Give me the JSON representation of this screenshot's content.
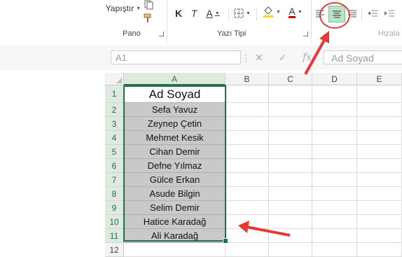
{
  "ribbon": {
    "paste_label": "Yapıştır",
    "group_pano": "Pano",
    "group_font": "Yazı Tipi",
    "group_align": "Hizala",
    "bold": "K",
    "italic": "T",
    "underline": "A",
    "font_color_letter": "A"
  },
  "formula_bar": {
    "name_box": "A1",
    "formula_value": "Ad Soyad"
  },
  "columns": [
    "A",
    "B",
    "C",
    "D",
    "E"
  ],
  "rows": [
    {
      "num": "1",
      "value": "Ad Soyad"
    },
    {
      "num": "2",
      "value": "Sefa Yavuz"
    },
    {
      "num": "3",
      "value": "Zeynep Çetin"
    },
    {
      "num": "4",
      "value": "Mehmet Kesik"
    },
    {
      "num": "5",
      "value": "Cihan Demir"
    },
    {
      "num": "6",
      "value": "Defne Yılmaz"
    },
    {
      "num": "7",
      "value": "Gülce Erkan"
    },
    {
      "num": "8",
      "value": "Asude Bilgin"
    },
    {
      "num": "9",
      "value": "Selim Demir"
    },
    {
      "num": "10",
      "value": "Hatice Karadağ"
    },
    {
      "num": "11",
      "value": "Ali Karadağ"
    },
    {
      "num": "12",
      "value": ""
    }
  ],
  "colors": {
    "excel_green": "#217346",
    "selection_fill": "#c9c9c9",
    "annotation_red": "#e53935",
    "active_align_fill": "#b7e4c7"
  }
}
